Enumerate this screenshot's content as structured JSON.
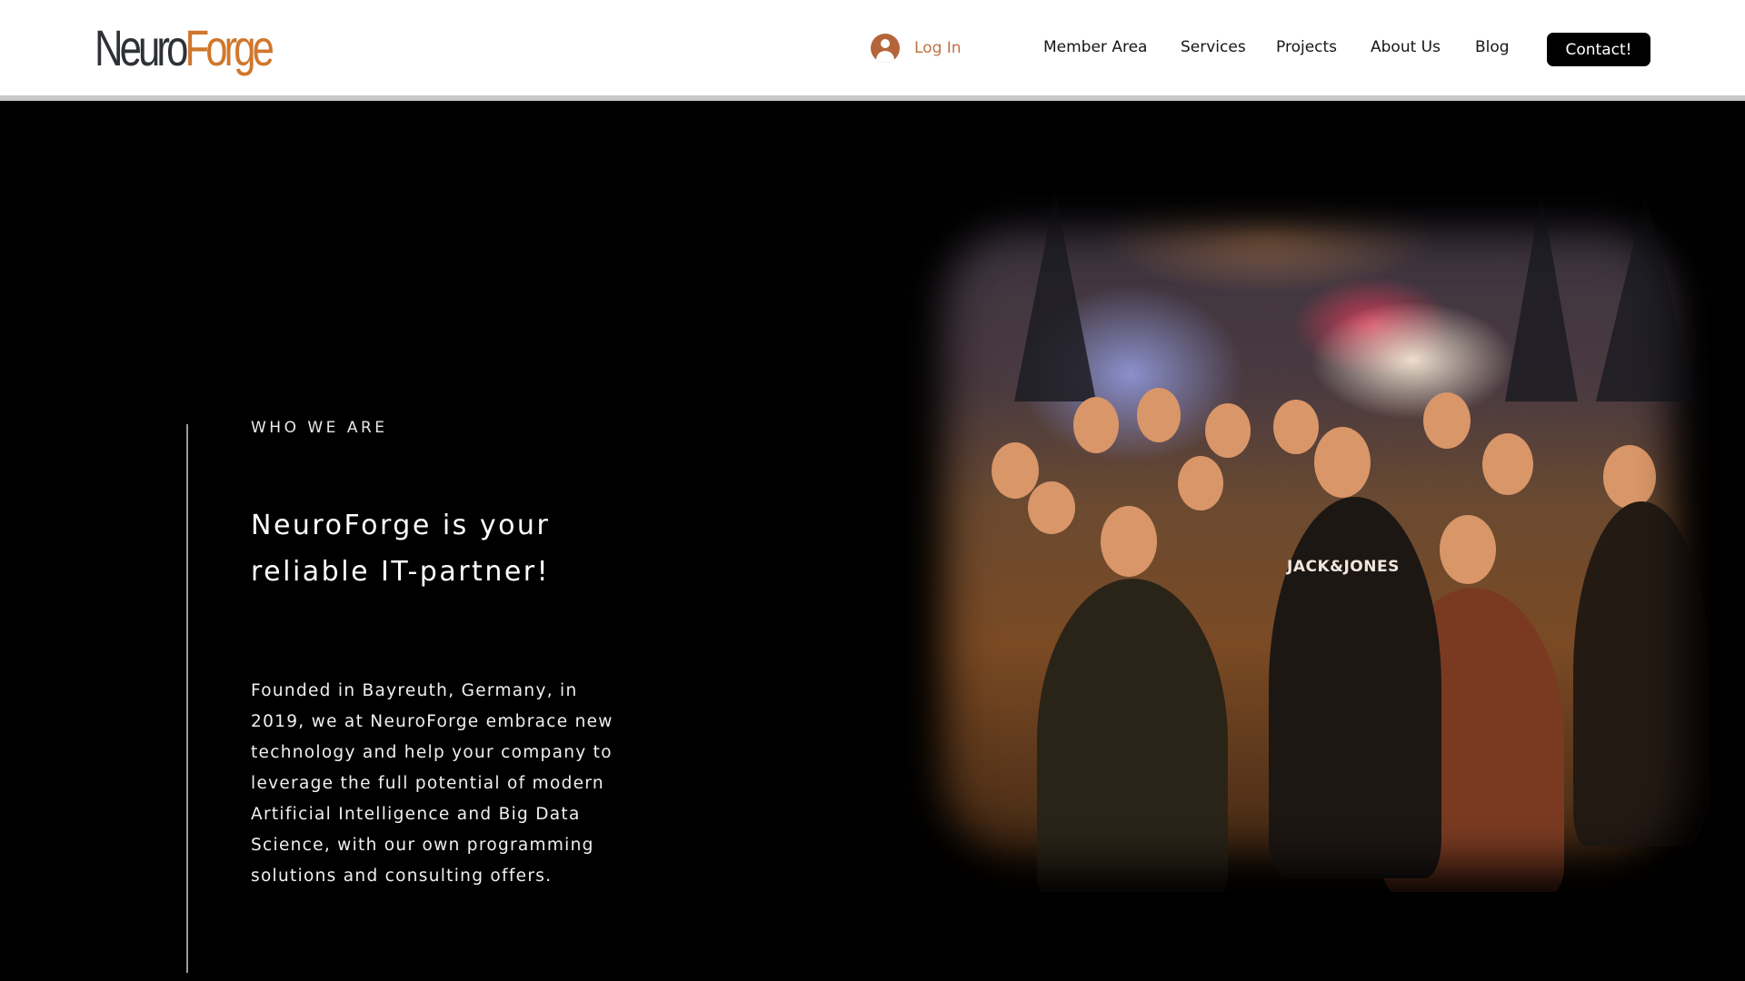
{
  "brand": {
    "logo_part1": "Neuro",
    "logo_part2": "Forge"
  },
  "header": {
    "login_label": "Log In",
    "nav": [
      "Member Area",
      "Services",
      "Projects",
      "About Us",
      "Blog"
    ],
    "contact_label": "Contact!"
  },
  "hero": {
    "eyebrow": "WHO WE ARE",
    "headline": "NeuroForge is your reliable IT-partner!",
    "paragraph": "Founded in Bayreuth, Germany, in 2019, we at NeuroForge embrace new technology and help your company to leverage the full potential of modern Artificial Intelligence and Big Data Science, with our own programming solutions and consulting offers."
  },
  "photo": {
    "shirt_print": "JACK&JONES"
  },
  "colors": {
    "accent": "#d0772c",
    "logo_dark": "#2f3138",
    "login": "#c1703f",
    "background": "#000000"
  },
  "icons": {
    "login": "user-avatar-icon"
  }
}
